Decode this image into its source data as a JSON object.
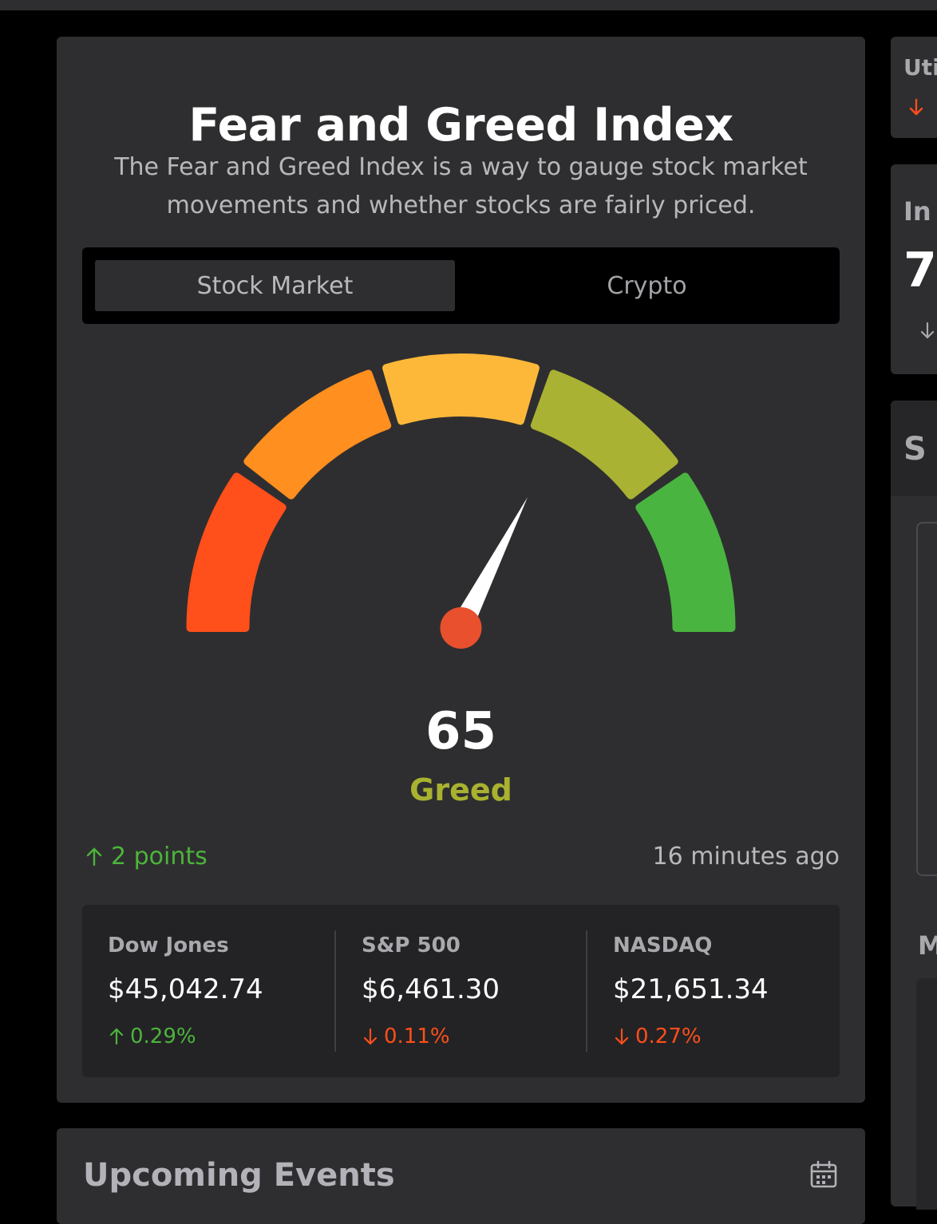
{
  "fear_greed": {
    "title": "Fear and Greed Index",
    "description": "The Fear and Greed Index is a way to gauge stock market movements and whether stocks are fairly priced.",
    "tabs": [
      {
        "label": "Stock Market",
        "active": true
      },
      {
        "label": "Crypto",
        "active": false
      }
    ],
    "score": "65",
    "score_value": 65,
    "sentiment": "Greed",
    "change_icon": "arrow-up-icon",
    "change_text": "2 points",
    "updated": "16 minutes ago",
    "segment_colors": [
      "#ff4f1a",
      "#ff8f1f",
      "#fdb83a",
      "#a9b232",
      "#4ab440"
    ],
    "needle_color": "#ffffff",
    "needle_hub_color": "#e8502e"
  },
  "indices": [
    {
      "name": "Dow Jones",
      "price": "$45,042.74",
      "direction": "up",
      "change": "0.29%"
    },
    {
      "name": "S&P 500",
      "price": "$6,461.30",
      "direction": "down",
      "change": "0.11%"
    },
    {
      "name": "NASDAQ",
      "price": "$21,651.34",
      "direction": "down",
      "change": "0.27%"
    }
  ],
  "upcoming_events": {
    "title": "Upcoming Events",
    "icon": "calendar-icon"
  },
  "side_panel": {
    "card1_label": "Uti",
    "card2_label": "In",
    "card2_value": "7",
    "card3_label": "S",
    "card4_label": "M"
  },
  "colors": {
    "up": "#4cb43b",
    "down": "#ff4e1a",
    "card_bg": "#2e2e30"
  }
}
